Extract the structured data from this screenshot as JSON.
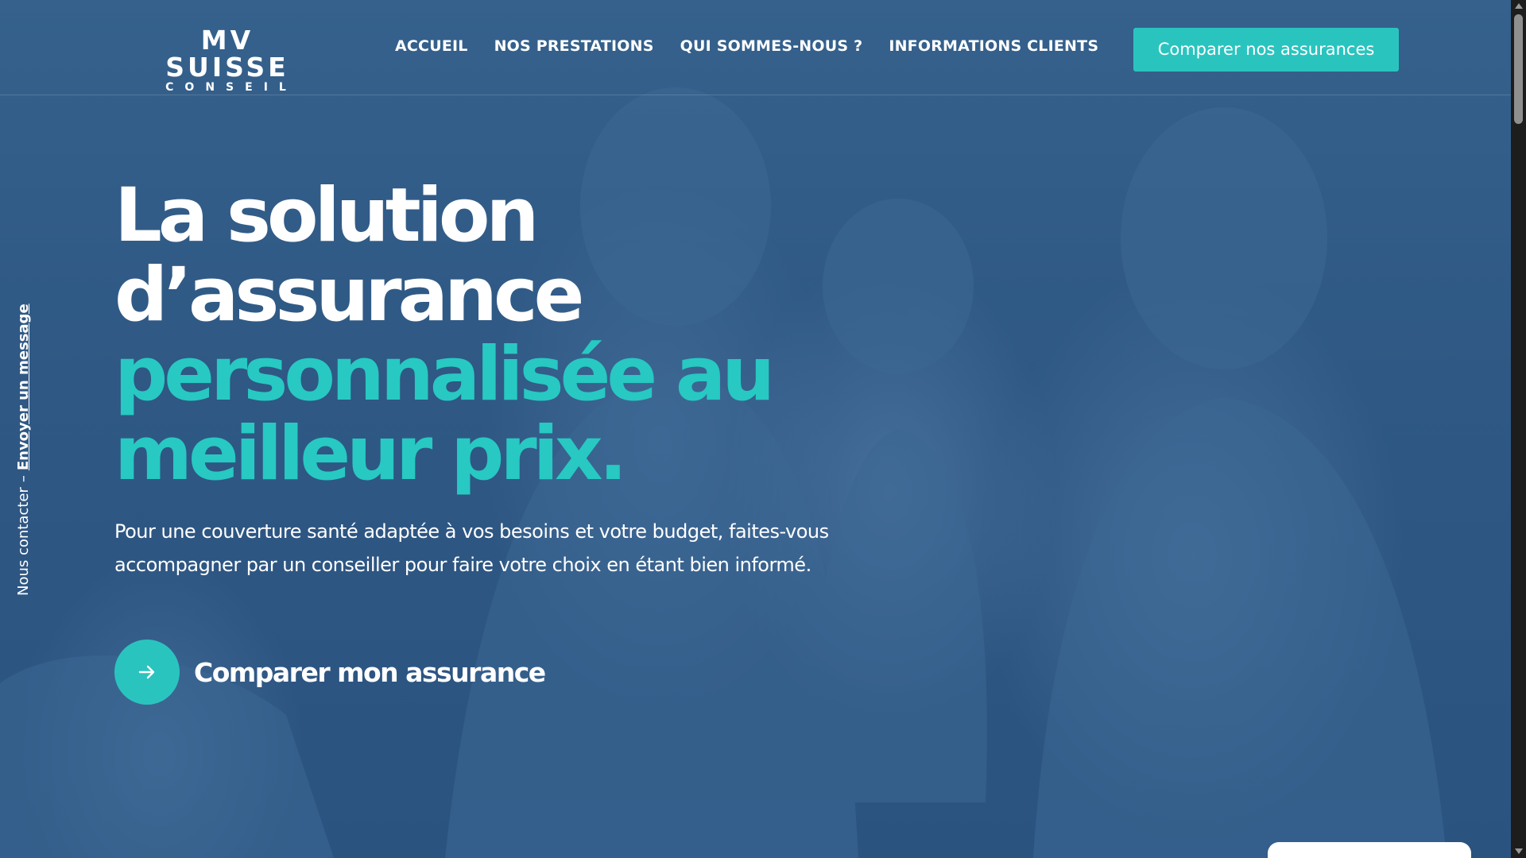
{
  "brand": {
    "logo_main": "MV SUISSE",
    "logo_sub": "CONSEIL"
  },
  "nav": {
    "items": [
      {
        "label": "ACCUEIL"
      },
      {
        "label": "NOS PRESTATIONS"
      },
      {
        "label": "QUI SOMMES-NOUS ?"
      },
      {
        "label": "INFORMATIONS CLIENTS"
      }
    ],
    "cta_label": "Comparer nos assurances"
  },
  "side_contact": {
    "label": "Nous contacter",
    "separator": "–",
    "link_label": "Envoyer un message"
  },
  "hero": {
    "title_line1": "La solution",
    "title_line2": "d’assurance",
    "title_line3": "personnalisée au",
    "title_line4": "meilleur prix.",
    "description": "Pour une couverture santé adaptée à vos besoins et votre budget, faites-vous accompagner par un conseiller pour faire votre choix en étant bien informé.",
    "cta_label": "Comparer mon assurance",
    "cta_icon": "arrow-right-icon",
    "background_image": "family-photo"
  },
  "colors": {
    "accent": "#2ac4bf",
    "overlay": "#2e5781",
    "text": "#ffffff"
  }
}
